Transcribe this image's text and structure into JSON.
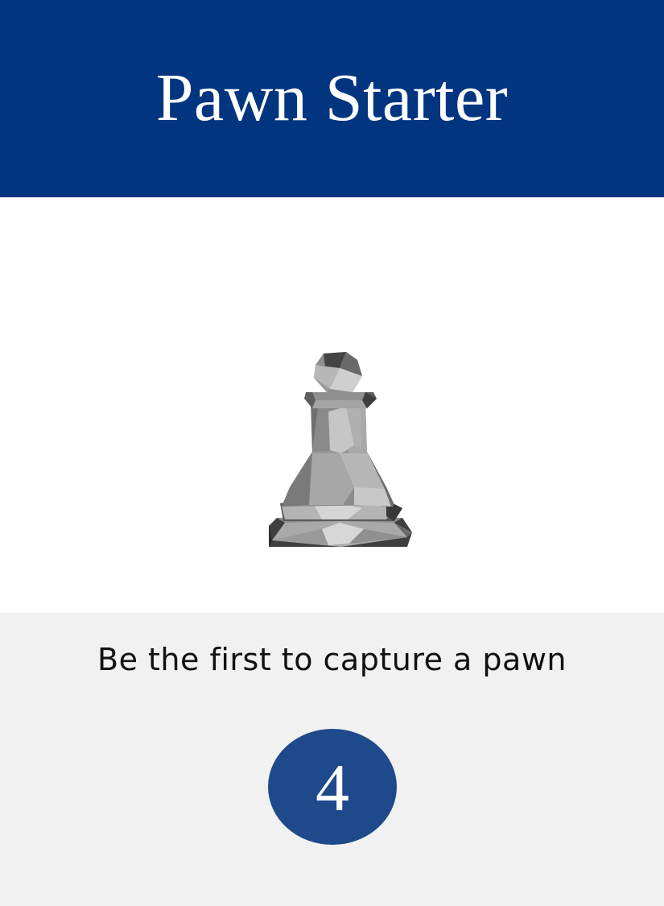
{
  "card": {
    "title": "Pawn Starter",
    "description": "Be the first to capture a pawn",
    "points": "4",
    "illustration": "pawn-icon"
  },
  "colors": {
    "header_bg": "#013580",
    "footer_bg": "#f1f1f1",
    "badge_bg": "#1e4a8c",
    "title_text": "#ffffff",
    "description_text": "#111111"
  }
}
